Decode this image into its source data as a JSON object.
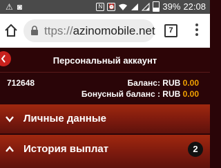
{
  "status_bar": {
    "notif_glyph_1": "⚠",
    "notif_glyph_2": "◙",
    "battery_percent": "39%",
    "time": "22:08",
    "battery_level": 0.39
  },
  "browser": {
    "url_scheme": "ttps://",
    "url_host": "azinomobile.net",
    "tabs_count": "7"
  },
  "header": {
    "title": "Персональный аккаунт"
  },
  "account": {
    "id": "712648",
    "balance_label": "Баланс: RUB ",
    "balance_value": "0.00",
    "bonus_label": "Бонусный баланс : RUB ",
    "bonus_value": "0.00"
  },
  "sections": {
    "personal": {
      "label": "Личные данные"
    },
    "history": {
      "label": "История выплат",
      "badge": "2"
    }
  },
  "colors": {
    "accent": "#f0a000",
    "header_bg": "#2d0507",
    "section_bg": "#8a1e0f"
  }
}
